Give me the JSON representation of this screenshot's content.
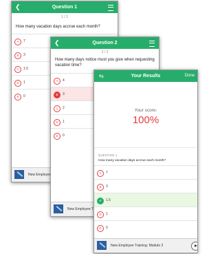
{
  "card1": {
    "title": "Question 1",
    "counter": "1 / 2",
    "question": "How many vacation days accrue each month?",
    "options": [
      {
        "letter": "A",
        "text": "7"
      },
      {
        "letter": "B",
        "text": "3"
      },
      {
        "letter": "C",
        "text": "1.5"
      },
      {
        "letter": "D",
        "text": "1"
      },
      {
        "letter": "E",
        "text": "0"
      }
    ],
    "footer": "New Employee Training: Module 3"
  },
  "card2": {
    "title": "Question 2",
    "counter": "2 / 2",
    "question": "How many days notice must you give when requesting vacation time?",
    "options": [
      {
        "letter": "A",
        "text": "4"
      },
      {
        "letter": "B",
        "text": "3",
        "state": "selected"
      },
      {
        "letter": "C",
        "text": "2"
      },
      {
        "letter": "D",
        "text": "1"
      },
      {
        "letter": "E",
        "text": "0"
      }
    ],
    "footer": "New Employee Training: Module 3"
  },
  "card3": {
    "title": "Your Results",
    "done_label": "Done",
    "score_label": "Your score:",
    "score_value": "100%",
    "question_number": "QUESTION 1",
    "question": "How many vacation days accrue each month?",
    "options": [
      {
        "letter": "A",
        "text": "7"
      },
      {
        "letter": "B",
        "text": "3"
      },
      {
        "letter": "C",
        "text": "1.5",
        "state": "correct"
      },
      {
        "letter": "D",
        "text": "1"
      },
      {
        "letter": "E",
        "text": "0"
      }
    ],
    "footer": "New Employee Training: Module 3"
  },
  "colors": {
    "header_green": "#27ad6b",
    "accent_red": "#e33c40",
    "correct_bg": "#eaf8e1",
    "selected_bg": "#fbe5e5"
  },
  "icons": [
    "back-arrow-icon",
    "menu-icon",
    "swap-icon",
    "check-icon",
    "play-icon",
    "course-thumbnail"
  ]
}
